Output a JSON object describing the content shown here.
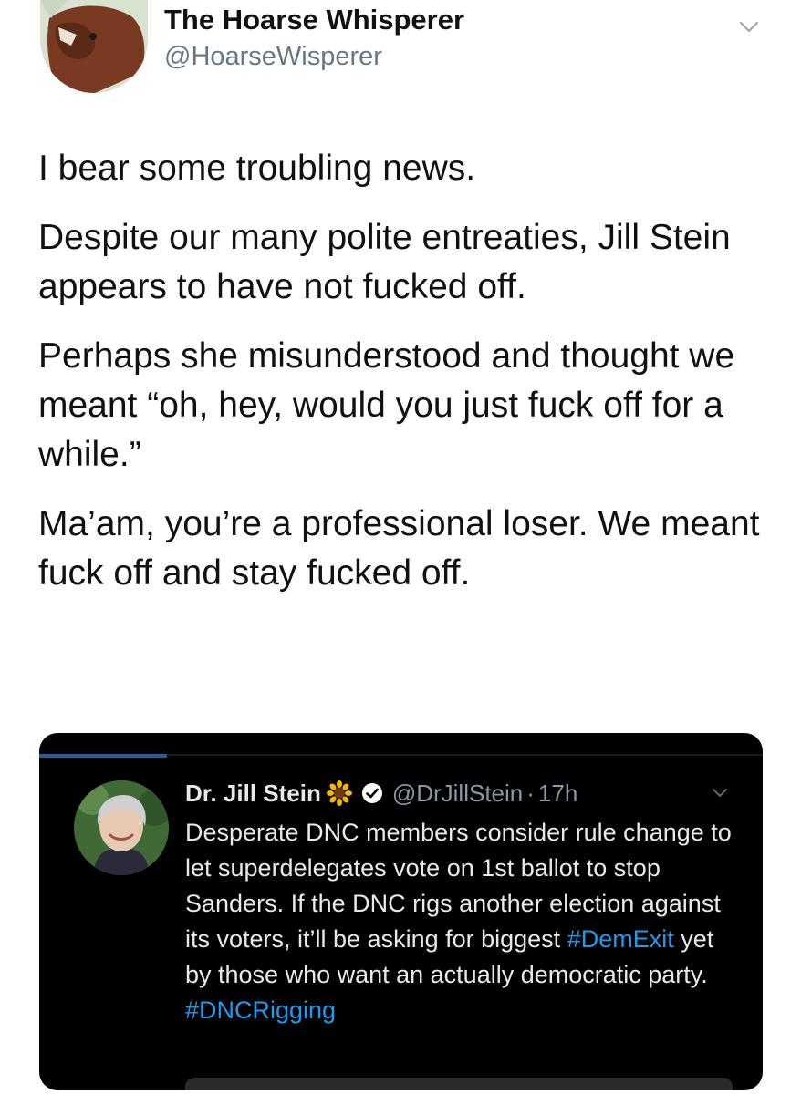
{
  "tweet": {
    "author_name": "The Hoarse Whisperer",
    "author_handle": "@HoarseWisperer",
    "paragraphs": [
      "I bear some troubling news.",
      "Despite our many polite entreaties, Jill Stein appears to have not fucked off.",
      "Perhaps she misunderstood and thought we meant “oh, hey, would you just fuck off for a while.”",
      "Ma’am, you’re a professional loser. We meant fuck off and stay fucked off."
    ]
  },
  "quoted": {
    "author_name": "Dr. Jill Stein",
    "author_handle": "@DrJillStein",
    "separator": "·",
    "time": "17h",
    "text_part1": "Desperate DNC members consider rule change to let superdelegates vote on 1st ballot to stop Sanders. If the DNC rigs another election against its voters, it’ll be asking for biggest ",
    "hashtag1": "#DemExit",
    "text_part2": " yet by those who want an actually democratic party.",
    "hashtag2": "#DNCRigging"
  },
  "colors": {
    "link": "#1d9bf0",
    "card_bg": "#000000",
    "handle_gray": "#657786"
  },
  "icons": {
    "author_avatar": "horse-avatar-icon",
    "tweet_menu": "chevron-down-icon",
    "quoted_avatar": "user-avatar-icon",
    "sunflower": "sunflower-icon",
    "verified": "verified-badge-icon",
    "quoted_menu": "chevron-down-icon"
  }
}
